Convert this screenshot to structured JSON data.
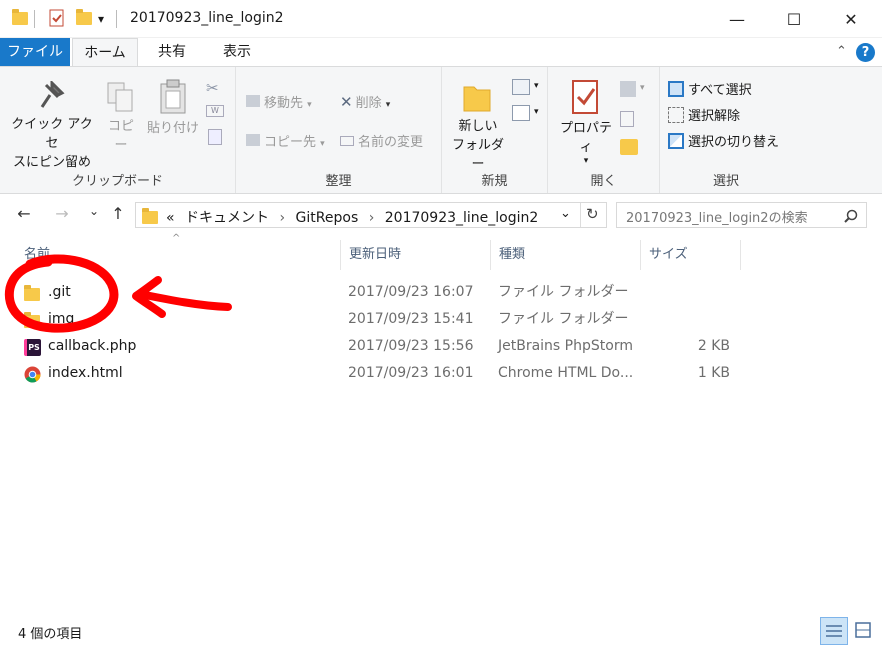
{
  "window": {
    "title": "20170923_line_login2",
    "qat_dropdown_glyph": "▾",
    "minimize_glyph": "—",
    "maximize_glyph": "☐",
    "close_glyph": "✕"
  },
  "tabs": {
    "file": "ファイル",
    "home": "ホーム",
    "share": "共有",
    "view": "表示"
  },
  "ribbon": {
    "expand_glyph": "⌃",
    "help_glyph": "?",
    "clipboard": {
      "label": "クリップボード",
      "pin_line1": "クイック アクセ",
      "pin_line2": "スにピン留め",
      "copy": "コピー",
      "paste": "貼り付け"
    },
    "organize": {
      "label": "整理",
      "move_to": "移動先",
      "delete": "削除",
      "copy_to": "コピー先",
      "rename": "名前の変更"
    },
    "new": {
      "label": "新規",
      "new_folder_line1": "新しい",
      "new_folder_line2": "フォルダー"
    },
    "open": {
      "label": "開く",
      "properties": "プロパティ"
    },
    "select": {
      "label": "選択",
      "select_all": "すべて選択",
      "select_none": "選択解除",
      "invert_selection": "選択の切り替え"
    }
  },
  "nav": {
    "back_glyph": "←",
    "forward_glyph": "→",
    "recent_glyph": "⌄",
    "up_glyph": "↑",
    "breadcrumb_overflow": "«",
    "breadcrumb": [
      "ドキュメント",
      "GitRepos",
      "20170923_line_login2"
    ],
    "breadcrumb_separator": "›",
    "search_placeholder": "20170923_line_login2の検索",
    "refresh_glyph": "↻",
    "dropdown_glyph": "⌄"
  },
  "columns": {
    "name": "名前",
    "modified": "更新日時",
    "type": "種類",
    "size": "サイズ",
    "sort_glyph": "^"
  },
  "files": [
    {
      "name": ".git",
      "modified": "2017/09/23 16:07",
      "type": "ファイル フォルダー",
      "size": "",
      "icon": "folder-icon"
    },
    {
      "name": "img",
      "modified": "2017/09/23 15:41",
      "type": "ファイル フォルダー",
      "size": "",
      "icon": "folder-icon"
    },
    {
      "name": "callback.php",
      "modified": "2017/09/23 15:56",
      "type": "JetBrains PhpStorm",
      "size": "2 KB",
      "icon": "phpstorm-icon",
      "icon_text": "PS"
    },
    {
      "name": "index.html",
      "modified": "2017/09/23 16:01",
      "type": "Chrome HTML Do...",
      "size": "1 KB",
      "icon": "chrome-icon"
    }
  ],
  "status": {
    "item_count": "4 個の項目"
  },
  "colors": {
    "accent": "#1979ca",
    "folder": "#f7c94a",
    "annotation": "#ff0000",
    "ribbon_bg": "#f5f6f7"
  }
}
